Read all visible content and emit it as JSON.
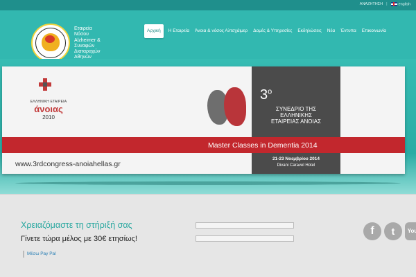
{
  "topbar": {
    "search_label": "ΑΝΑΖΗΤΗΣΗ",
    "separator": "|",
    "language_label": "english"
  },
  "header": {
    "org_name": [
      "Εταιρεία",
      "Νόσου",
      "Alzheimer &",
      "Συναφών",
      "Διαταραχών",
      "Αθηνών"
    ],
    "nav": [
      {
        "label": "Αρχική",
        "active": true
      },
      {
        "label": "Η Εταιρεία"
      },
      {
        "label": "Άνοια & νόσος Αλτσχάιμερ"
      },
      {
        "label": "Δομές & Υπηρεσίες"
      },
      {
        "label": "Εκδηλώσεις"
      },
      {
        "label": "Νέα"
      },
      {
        "label": "Έντυπα"
      },
      {
        "label": "Επικοινωνία"
      }
    ]
  },
  "banner": {
    "society_small": "ΕΛΛΗΝΙΚΗ ΕΤΑΙΡΕΙΑ",
    "society_big": "άνοιας",
    "society_year": "2010",
    "congress_num": "3",
    "congress_sup": "ο",
    "congress_lines": [
      "ΣΥΝΕΔΡΙΟ ΤΗΣ",
      "ΕΛΛΗΝΙΚΗΣ",
      "ΕΤΑΙΡΕΙΑΣ ΑΝΟΙΑΣ"
    ],
    "headline": "Master Classes in Dementia 2014",
    "url": "www.3rdcongress-anoiahellas.gr",
    "dates": "21-23 Νοεμβρίου 2014",
    "venue": "Divani Caravel Hotel"
  },
  "footer": {
    "support_title": "Χρειαζόμαστε τη στήριξή σας",
    "support_sub": "Γίνετε τώρα μέλος με 30€ ετησίως!",
    "paypal_label": "Μέσω Pay Pal"
  },
  "social": [
    {
      "icon": "facebook-icon",
      "glyph": "f"
    },
    {
      "icon": "twitter-icon",
      "glyph": "t"
    },
    {
      "icon": "youtube-icon",
      "glyph": "You"
    }
  ],
  "colors": {
    "teal": "#32b8b0",
    "teal_dark": "#1f8f8c",
    "red": "#c2272d",
    "panel": "#4b4b4b",
    "link": "#2aa8a0"
  }
}
